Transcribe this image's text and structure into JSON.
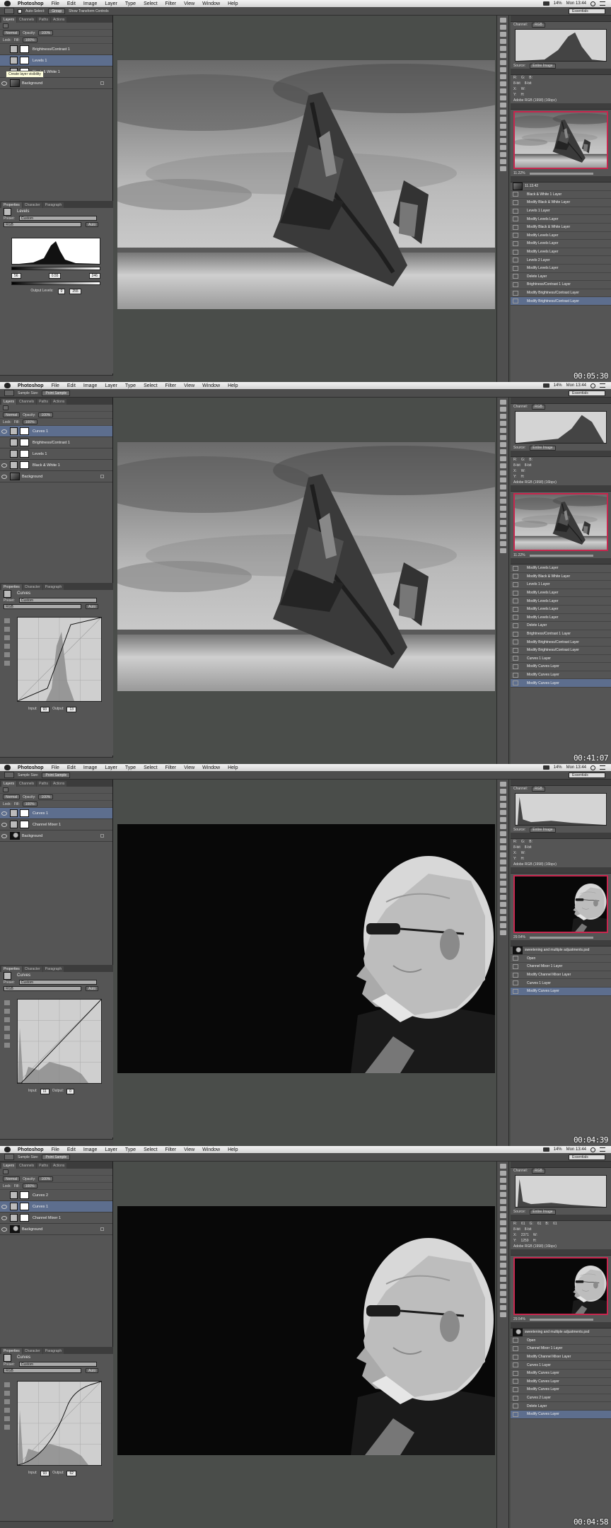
{
  "app": {
    "name": "Photoshop",
    "menus": [
      "File",
      "Edit",
      "Image",
      "Layer",
      "Type",
      "Select",
      "Filter",
      "View",
      "Window",
      "Help"
    ],
    "workspace": "Essentials",
    "status": {
      "battery": "14%",
      "time": "Mon 13:44"
    }
  },
  "colors": {
    "accent": "#c8264e",
    "selection": "#5d6e8e",
    "panel": "#555555",
    "pasteboard": "#4a4d4a"
  },
  "frames": [
    {
      "timecode": "00:05:30",
      "options": [
        "Auto-Select:",
        "Group",
        "Show Transform Controls"
      ],
      "layers_tabs": [
        "Layers",
        "Channels",
        "Paths",
        "Actions"
      ],
      "blend": "Normal",
      "opacity_label": "Opacity:",
      "opacity": "100%",
      "fill_label": "Fill:",
      "fill": "100%",
      "lock_label": "Lock:",
      "tooltip": "Create layer visibility",
      "layers": [
        {
          "name": "Brightness/Contrast 1",
          "kind": "adj",
          "visible": false
        },
        {
          "name": "Levels 1",
          "kind": "adj",
          "visible": false,
          "selected": true
        },
        {
          "name": "Black & White 1",
          "kind": "adj",
          "visible": false
        },
        {
          "name": "Background",
          "kind": "photo-boat",
          "visible": true,
          "locked": true
        }
      ],
      "props_tabs": [
        "Properties",
        "Character",
        "Paragraph"
      ],
      "adj_title": "Levels",
      "preset_label": "Preset:",
      "preset": "Custom",
      "channel": "RGB",
      "auto": "Auto",
      "levels_inputs": [
        "56",
        "0.55",
        "246"
      ],
      "output_label": "Output Levels:",
      "output": [
        "0",
        "255"
      ],
      "histogram": {
        "channel_label": "Channel:",
        "channel": "RGB",
        "source_label": "Source:",
        "source": "Entire Image"
      },
      "info": {
        "r": "R:",
        "g": "G:",
        "b": "B:",
        "bits": "8-bit",
        "x": "X:",
        "y": "Y:",
        "w": "W:",
        "h": "H:",
        "profile": "Adobe RGB (1998) (16bpc)"
      },
      "zoom": "11.22%",
      "history_doc": "11.13.42",
      "history": [
        "Black & White 1 Layer",
        "Modify Black & White Layer",
        "Levels 1 Layer",
        "Modify Levels Layer",
        "Modify Black & White Layer",
        "Modify Levels Layer",
        "Modify Levels Layer",
        "Modify Levels Layer",
        "Levels 2 Layer",
        "Modify Levels Layer",
        "Delete Layer",
        "Brightness/Contrast 1 Layer",
        "Modify Brightness/Contrast Layer",
        "Modify Brightness/Contrast Layer"
      ],
      "photo": "boat"
    },
    {
      "timecode": "00:41:07",
      "options": [
        "Sample Size:",
        "Point Sample"
      ],
      "layers_tabs": [
        "Layers",
        "Channels",
        "Paths",
        "Actions"
      ],
      "blend": "Normal",
      "opacity_label": "Opacity:",
      "opacity": "100%",
      "fill_label": "Fill:",
      "fill": "100%",
      "lock_label": "Lock:",
      "layers": [
        {
          "name": "Curves 1",
          "kind": "adj",
          "visible": true,
          "selected": true
        },
        {
          "name": "Brightness/Contrast 1",
          "kind": "adj",
          "visible": false
        },
        {
          "name": "Levels 1",
          "kind": "adj",
          "visible": false
        },
        {
          "name": "Black & White 1",
          "kind": "adj",
          "visible": true
        },
        {
          "name": "Background",
          "kind": "photo-boat",
          "visible": true,
          "locked": true
        }
      ],
      "props_tabs": [
        "Properties",
        "Character",
        "Paragraph"
      ],
      "adj_title": "Curves",
      "preset_label": "Preset:",
      "preset": "Custom",
      "channel": "RGB",
      "auto": "Auto",
      "input_label": "Input:",
      "input": "93",
      "output_label": "Output:",
      "output": "13",
      "histogram": {
        "channel_label": "Channel:",
        "channel": "RGB",
        "source_label": "Source:",
        "source": "Entire Image"
      },
      "info": {
        "r": "R:",
        "g": "G:",
        "b": "B:",
        "bits": "8-bit",
        "x": "X:",
        "y": "Y:",
        "w": "W:",
        "h": "H:",
        "profile": "Adobe RGB (1998) (16bpc)"
      },
      "zoom": "11.22%",
      "history": [
        "Modify Levels Layer",
        "Modify Black & White Layer",
        "Levels 1 Layer",
        "Modify Levels Layer",
        "Modify Levels Layer",
        "Modify Levels Layer",
        "Modify Levels Layer",
        "Delete Layer",
        "Brightness/Contrast 1 Layer",
        "Modify Brightness/Contrast Layer",
        "Modify Brightness/Contrast Layer",
        "Curves 1 Layer",
        "Modify Curves Layer",
        "Modify Curves Layer",
        "Modify Curves Layer"
      ],
      "photo": "boat"
    },
    {
      "timecode": "00:04:39",
      "options": [
        "Sample Size:",
        "Point Sample"
      ],
      "layers_tabs": [
        "Layers",
        "Channels",
        "Paths",
        "Actions"
      ],
      "blend": "Normal",
      "opacity_label": "Opacity:",
      "opacity": "100%",
      "fill_label": "Fill:",
      "fill": "100%",
      "lock_label": "Lock:",
      "layers": [
        {
          "name": "Curves 1",
          "kind": "adj",
          "visible": true,
          "selected": true
        },
        {
          "name": "Channel Mixer 1",
          "kind": "adj",
          "visible": true
        },
        {
          "name": "Background",
          "kind": "photo-portrait",
          "visible": true,
          "locked": true
        }
      ],
      "props_tabs": [
        "Properties",
        "Character",
        "Paragraph"
      ],
      "adj_title": "Curves",
      "preset_label": "Preset:",
      "preset": "Custom",
      "channel": "RGB",
      "auto": "Auto",
      "input_label": "Input:",
      "input": "11",
      "output_label": "Output:",
      "output": "0",
      "histogram": {
        "channel_label": "Channel:",
        "channel": "RGB",
        "source_label": "Source:",
        "source": "Entire Image"
      },
      "info": {
        "r": "R:",
        "g": "G:",
        "b": "B:",
        "bits": "8-bit",
        "x": "X:",
        "y": "Y:",
        "w": "W:",
        "h": "H:",
        "profile": "Adobe RGB (1998) (16bpc)"
      },
      "zoom": "29.54%",
      "history_doc": "sweetening and multiple adjustments.psd",
      "history": [
        "Open",
        "Channel Mixer 1 Layer",
        "Modify Channel Mixer Layer",
        "Curves 1 Layer",
        "Modify Curves Layer"
      ],
      "photo": "portrait"
    },
    {
      "timecode": "00:04:58",
      "options": [
        "Sample Size:",
        "Point Sample"
      ],
      "layers_tabs": [
        "Layers",
        "Channels",
        "Paths",
        "Actions"
      ],
      "blend": "Normal",
      "opacity_label": "Opacity:",
      "opacity": "100%",
      "fill_label": "Fill:",
      "fill": "100%",
      "lock_label": "Lock:",
      "layers": [
        {
          "name": "Curves 2",
          "kind": "adj",
          "visible": false
        },
        {
          "name": "Curves 1",
          "kind": "adj",
          "visible": true,
          "selected": true
        },
        {
          "name": "Channel Mixer 1",
          "kind": "adj",
          "visible": true
        },
        {
          "name": "Background",
          "kind": "photo-portrait",
          "visible": true,
          "locked": true
        }
      ],
      "props_tabs": [
        "Properties",
        "Character",
        "Paragraph"
      ],
      "adj_title": "Curves",
      "preset_label": "Preset:",
      "preset": "Custom",
      "channel": "RGB",
      "auto": "Auto",
      "input_label": "Input:",
      "input": "93",
      "output_label": "Output:",
      "output": "62",
      "histogram": {
        "channel_label": "Channel:",
        "channel": "RGB",
        "source_label": "Source:",
        "source": "Entire Image"
      },
      "info": {
        "r": "R:",
        "g": "G:",
        "b": "B:",
        "rv": "61",
        "gv": "61",
        "bv": "61",
        "bits": "8-bit",
        "x": "X:",
        "y": "Y:",
        "xv": "2371",
        "yv": "1259",
        "w": "W:",
        "h": "H:",
        "profile": "Adobe RGB (1998) (16bpc)"
      },
      "zoom": "29.54%",
      "history_doc": "sweetening and multiple adjustments.psd",
      "history": [
        "Open",
        "Channel Mixer 1 Layer",
        "Modify Channel Mixer Layer",
        "Curves 1 Layer",
        "Modify Curves Layer",
        "Modify Curves Layer",
        "Modify Curves Layer",
        "Curves 2 Layer",
        "Delete Layer",
        "Modify Curves Layer"
      ],
      "photo": "portrait"
    }
  ]
}
